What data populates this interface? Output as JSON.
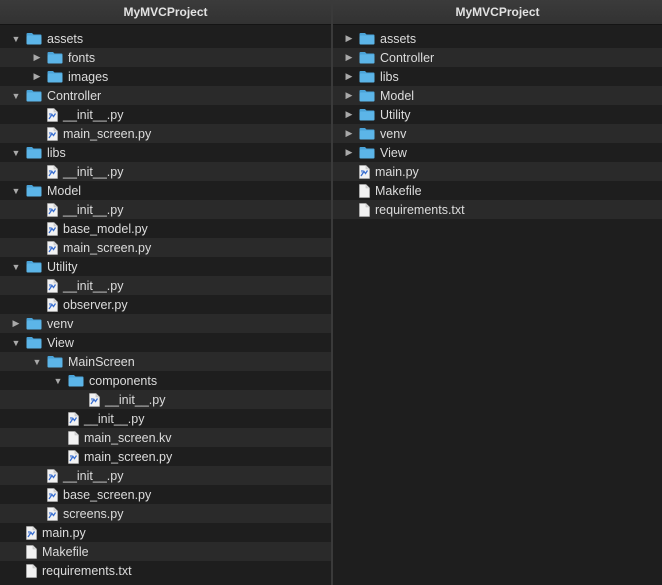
{
  "left": {
    "title": "MyMVCProject",
    "rows": [
      {
        "depth": 0,
        "type": "folder",
        "state": "open",
        "label": "assets"
      },
      {
        "depth": 1,
        "type": "folder",
        "state": "closed",
        "label": "fonts"
      },
      {
        "depth": 1,
        "type": "folder",
        "state": "closed",
        "label": "images"
      },
      {
        "depth": 0,
        "type": "folder",
        "state": "open",
        "label": "Controller"
      },
      {
        "depth": 1,
        "type": "py",
        "label": "__init__.py"
      },
      {
        "depth": 1,
        "type": "py",
        "label": "main_screen.py"
      },
      {
        "depth": 0,
        "type": "folder",
        "state": "open",
        "label": "libs"
      },
      {
        "depth": 1,
        "type": "py",
        "label": "__init__.py"
      },
      {
        "depth": 0,
        "type": "folder",
        "state": "open",
        "label": "Model"
      },
      {
        "depth": 1,
        "type": "py",
        "label": "__init__.py"
      },
      {
        "depth": 1,
        "type": "py",
        "label": "base_model.py"
      },
      {
        "depth": 1,
        "type": "py",
        "label": "main_screen.py"
      },
      {
        "depth": 0,
        "type": "folder",
        "state": "open",
        "label": "Utility"
      },
      {
        "depth": 1,
        "type": "py",
        "label": "__init__.py"
      },
      {
        "depth": 1,
        "type": "py",
        "label": "observer.py"
      },
      {
        "depth": 0,
        "type": "folder",
        "state": "closed",
        "label": "venv"
      },
      {
        "depth": 0,
        "type": "folder",
        "state": "open",
        "label": "View"
      },
      {
        "depth": 1,
        "type": "folder",
        "state": "open",
        "label": "MainScreen"
      },
      {
        "depth": 2,
        "type": "folder",
        "state": "open",
        "label": "components"
      },
      {
        "depth": 3,
        "type": "py",
        "label": "__init__.py"
      },
      {
        "depth": 2,
        "type": "py",
        "label": "__init__.py"
      },
      {
        "depth": 2,
        "type": "doc",
        "label": "main_screen.kv"
      },
      {
        "depth": 2,
        "type": "py",
        "label": "main_screen.py"
      },
      {
        "depth": 1,
        "type": "py",
        "label": "__init__.py"
      },
      {
        "depth": 1,
        "type": "py",
        "label": "base_screen.py"
      },
      {
        "depth": 1,
        "type": "py",
        "label": "screens.py"
      },
      {
        "depth": 0,
        "type": "py",
        "label": "main.py"
      },
      {
        "depth": 0,
        "type": "doc",
        "label": "Makefile"
      },
      {
        "depth": 0,
        "type": "doc",
        "label": "requirements.txt"
      }
    ]
  },
  "right": {
    "title": "MyMVCProject",
    "rows": [
      {
        "depth": 0,
        "type": "folder",
        "state": "closed",
        "label": "assets"
      },
      {
        "depth": 0,
        "type": "folder",
        "state": "closed",
        "label": "Controller"
      },
      {
        "depth": 0,
        "type": "folder",
        "state": "closed",
        "label": "libs"
      },
      {
        "depth": 0,
        "type": "folder",
        "state": "closed",
        "label": "Model"
      },
      {
        "depth": 0,
        "type": "folder",
        "state": "closed",
        "label": "Utility"
      },
      {
        "depth": 0,
        "type": "folder",
        "state": "closed",
        "label": "venv"
      },
      {
        "depth": 0,
        "type": "folder",
        "state": "closed",
        "label": "View"
      },
      {
        "depth": 0,
        "type": "py",
        "label": "main.py"
      },
      {
        "depth": 0,
        "type": "doc",
        "label": "Makefile"
      },
      {
        "depth": 0,
        "type": "doc",
        "label": "requirements.txt"
      }
    ]
  },
  "colors": {
    "folder": "#5cb5e8",
    "folder_tab": "#4aa3d8",
    "doc": "#f2f2f2",
    "py_accent": "#3a6fd0"
  }
}
